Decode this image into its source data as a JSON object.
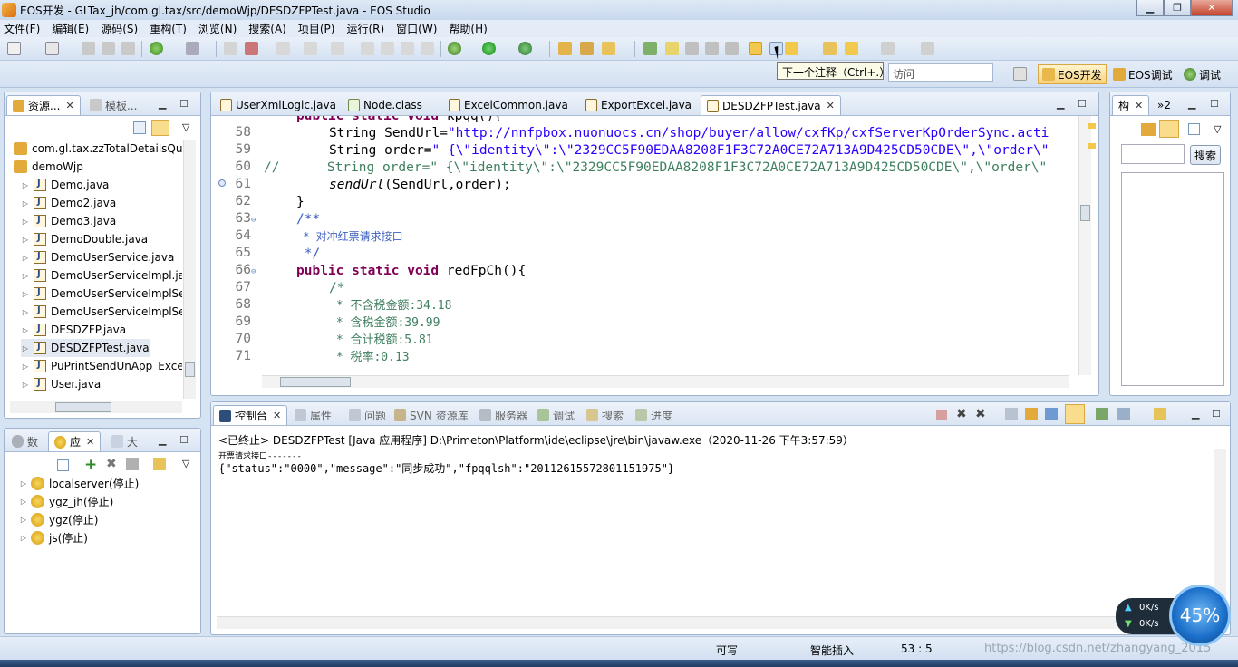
{
  "window": {
    "title": "EOS开发 - GLTax_jh/com.gl.tax/src/demoWjp/DESDZFPTest.java - EOS Studio",
    "minimize_icon": "minimize-icon",
    "maximize_icon": "restore-icon",
    "close_icon": "close-icon"
  },
  "menu": [
    "文件(F)",
    "编辑(E)",
    "源码(S)",
    "重构(T)",
    "浏览(N)",
    "搜索(A)",
    "项目(P)",
    "运行(R)",
    "窗口(W)",
    "帮助(H)"
  ],
  "toolbar": {
    "tooltip": "下一个注释（Ctrl+.）",
    "quick_access_placeholder": "访问",
    "perspectives": [
      "EOS开发",
      "EOS调试",
      "调试"
    ]
  },
  "explorer": {
    "tabs": [
      "资源...",
      "模板..."
    ],
    "items": [
      {
        "label": "com.gl.tax.zzTotalDetailsQu",
        "type": "package"
      },
      {
        "label": "demoWjp",
        "type": "package"
      },
      {
        "label": "Demo.java",
        "type": "java"
      },
      {
        "label": "Demo2.java",
        "type": "java"
      },
      {
        "label": "Demo3.java",
        "type": "java"
      },
      {
        "label": "DemoDouble.java",
        "type": "java"
      },
      {
        "label": "DemoUserService.java",
        "type": "java"
      },
      {
        "label": "DemoUserServiceImpl.ja",
        "type": "java"
      },
      {
        "label": "DemoUserServiceImplSe",
        "type": "java"
      },
      {
        "label": "DemoUserServiceImplSe",
        "type": "java"
      },
      {
        "label": "DESDZFP.java",
        "type": "java"
      },
      {
        "label": "DESDZFPTest.java",
        "type": "java",
        "selected": true
      },
      {
        "label": "PuPrintSendUnApp_Exce",
        "type": "java"
      },
      {
        "label": "User.java",
        "type": "java"
      }
    ]
  },
  "servers": {
    "tabs": [
      "数",
      "应",
      "大"
    ],
    "items": [
      "localserver(停止)",
      "ygz_jh(停止)",
      "ygz(停止)",
      "js(停止)"
    ]
  },
  "editor": {
    "tabs": [
      "UserXmlLogic.java",
      "Node.class",
      "ExcelCommon.java",
      "ExportExcel.java",
      "DESDZFPTest.java"
    ],
    "active_tab": "DESDZFPTest.java",
    "line_numbers": [
      "58",
      "59",
      "60",
      "61",
      "62",
      "63",
      "64",
      "65",
      "66",
      "67",
      "68",
      "69",
      "70",
      "71"
    ],
    "code": {
      "l58_kw": "String SendUrl=",
      "l58_str": "\"http://nnfpbox.nuonuocs.cn/shop/buyer/allow/cxfKp/cxfServerKpOrderSync.acti",
      "l59_kw": "String order=",
      "l59_str": "\" {\\\"identity\\\":\\\"2329CC5F90EDAA8208F1F3C72A0CE72A713A9D425CD50CDE\\\",\\\"order\\\"",
      "l60_cm": "//      String order=",
      "l60_str": "\" {\\\"identity\\\":\\\"2329CC5F90EDAA8208F1F3C72A0CE72A713A9D425CD50CDE\\\",\\\"order\\\"",
      "l61_call": "sendUrl",
      "l61_rest": "(SendUrl,order);",
      "l62": "}",
      "l63": "/**",
      "l64": " * 对冲红票请求接口",
      "l65": " */",
      "l66_kw": "public static void",
      "l66_rest": " redFpCh(){",
      "l67": "/*",
      "l68": " * 不含税金额:34.18",
      "l69": " * 含税金额:39.99",
      "l70": " * 合计税额:5.81",
      "l71": " * 税率:0.13"
    }
  },
  "outline": {
    "tabs": [
      "构",
      "»2"
    ],
    "search_button": "搜索"
  },
  "console": {
    "tabs": [
      "控制台",
      "属性",
      "问题",
      "SVN 资源库",
      "服务器",
      "调试",
      "搜索",
      "进度"
    ],
    "terminated_label": "<已终止> DESDZFPTest [Java 应用程序] D:\\Primeton\\Platform\\ide\\eclipse\\jre\\bin\\javaw.exe（2020-11-26 下午3:57:59）",
    "output_line1": "开票请求接口-------",
    "output_line2": "{\"status\":\"0000\",\"message\":\"同步成功\",\"fpqqlsh\":\"20112615572801151975\"}"
  },
  "status": {
    "writable": "可写",
    "insert_mode": "智能插入",
    "position": "53 : 5",
    "watermark": "https://blog.csdn.net/zhangyang_2015"
  },
  "network": {
    "up": "0K/s",
    "down": "0K/s",
    "gauge": "45%"
  }
}
